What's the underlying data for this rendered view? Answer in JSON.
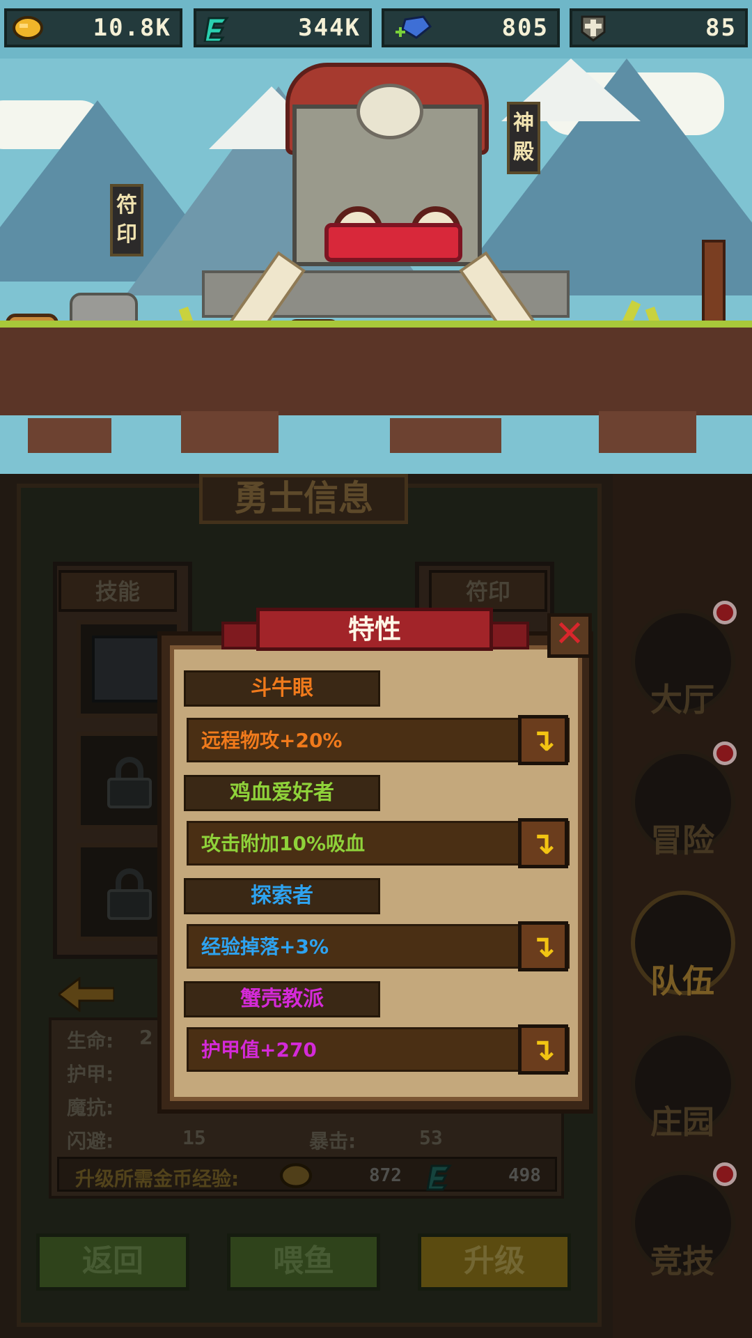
{
  "resources": [
    {
      "name": "gold",
      "value": "10.8K",
      "icon": "gold-coin-icon",
      "color": "#f0b52a"
    },
    {
      "name": "exp",
      "value": "344K",
      "icon": "green-exp-icon",
      "color": "#2ad0b0"
    },
    {
      "name": "gem",
      "value": "805",
      "icon": "blue-gem-icon",
      "color": "#3e6fd6"
    },
    {
      "name": "cross",
      "value": "85",
      "icon": "cross-shield-icon",
      "color": "#cfc9b8"
    }
  ],
  "scene": {
    "banner_left": "符\n印",
    "banner_right": "神\n殿"
  },
  "panel": {
    "title": "勇士信息",
    "skill_label": "技能",
    "rune_label": "符印",
    "stats": {
      "hp_label": "生命:",
      "hp_value": "2",
      "armor_label": "护甲:",
      "resist_label": "魔抗:",
      "dodge_label": "闪避:",
      "dodge_value": "15",
      "crit_label": "暴击:",
      "crit_value": "53"
    },
    "upgrade_cost_label": "升级所需金币经验:",
    "upgrade_gold": "872",
    "upgrade_exp": "498",
    "buttons": {
      "back": "返回",
      "feed": "喂鱼",
      "upgrade": "升级"
    }
  },
  "nav": [
    {
      "label": "大厅",
      "icon": "hall-icon",
      "badge": true
    },
    {
      "label": "冒险",
      "icon": "adventure-icon",
      "badge": true
    },
    {
      "label": "队伍",
      "icon": "team-icon",
      "badge": false
    },
    {
      "label": "庄园",
      "icon": "manor-icon",
      "badge": false
    },
    {
      "label": "竞技",
      "icon": "arena-icon",
      "badge": true
    }
  ],
  "popup": {
    "title": "特性",
    "close": "✕",
    "traits": [
      {
        "name": "斗牛眼",
        "desc": "远程物攻+20%",
        "color": "#f07a1c"
      },
      {
        "name": "鸡血爱好者",
        "desc": "攻击附加10%吸血",
        "color": "#8fd23a"
      },
      {
        "name": "探索者",
        "desc": "经验掉落+3%",
        "color": "#2ea3f0"
      },
      {
        "name": "蟹壳教派",
        "desc": "护甲值+270",
        "color": "#d42ad8"
      }
    ]
  }
}
